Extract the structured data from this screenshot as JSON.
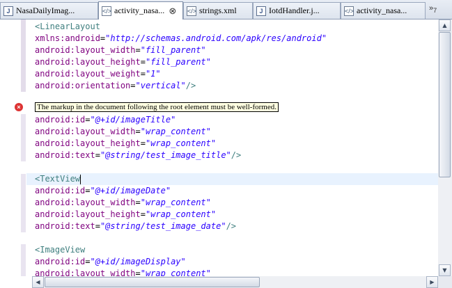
{
  "tabs": [
    {
      "label": "NasaDailyImag...",
      "icon": "java-file-icon",
      "active": false
    },
    {
      "label": "activity_nasa...",
      "icon": "xml-file-icon",
      "active": true
    },
    {
      "label": "strings.xml",
      "icon": "xml-file-icon",
      "active": false
    },
    {
      "label": "IotdHandler.j...",
      "icon": "java-file-icon",
      "active": false
    },
    {
      "label": "activity_nasa...",
      "icon": "xml-file-icon",
      "active": false
    }
  ],
  "tabs_overflow": "»",
  "tabs_overflow_count": "7",
  "close_glyph": "⊗",
  "code": [
    {
      "id": "l1",
      "parts": [
        [
          "tag",
          "<LinearLayout"
        ]
      ]
    },
    {
      "id": "l2",
      "parts": [
        [
          "attr",
          "xmlns:android"
        ],
        [
          "eq",
          "="
        ],
        [
          "val",
          "\"http://schemas.android.com/apk/res/android\""
        ]
      ]
    },
    {
      "id": "l3",
      "parts": [
        [
          "attr",
          "android:layout_width"
        ],
        [
          "eq",
          "="
        ],
        [
          "val",
          "\"fill_parent\""
        ]
      ]
    },
    {
      "id": "l4",
      "parts": [
        [
          "attr",
          "android:layout_height"
        ],
        [
          "eq",
          "="
        ],
        [
          "val",
          "\"fill_parent\""
        ]
      ]
    },
    {
      "id": "l5",
      "parts": [
        [
          "attr",
          "android:layout_weight"
        ],
        [
          "eq",
          "="
        ],
        [
          "val",
          "\"1\""
        ]
      ]
    },
    {
      "id": "l6",
      "parts": [
        [
          "attr",
          "android:orientation"
        ],
        [
          "eq",
          "="
        ],
        [
          "val",
          "\"vertical\""
        ],
        [
          "tag",
          "/>"
        ]
      ]
    },
    {
      "id": "l8",
      "parts": [
        [
          "attr",
          "android:id"
        ],
        [
          "eq",
          "="
        ],
        [
          "val",
          "\"@+id/imageTitle\""
        ]
      ]
    },
    {
      "id": "l9",
      "parts": [
        [
          "attr",
          "android:layout_width"
        ],
        [
          "eq",
          "="
        ],
        [
          "val",
          "\"wrap_content\""
        ]
      ]
    },
    {
      "id": "l10",
      "parts": [
        [
          "attr",
          "android:layout_height"
        ],
        [
          "eq",
          "="
        ],
        [
          "val",
          "\"wrap_content\""
        ]
      ]
    },
    {
      "id": "l11",
      "parts": [
        [
          "attr",
          "android:text"
        ],
        [
          "eq",
          "="
        ],
        [
          "val",
          "\"@string/test_image_title\""
        ],
        [
          "tag",
          "/>"
        ]
      ]
    },
    {
      "id": "l13",
      "parts": [
        [
          "tag",
          "<TextView"
        ]
      ]
    },
    {
      "id": "l14",
      "parts": [
        [
          "attr",
          "android:id"
        ],
        [
          "eq",
          "="
        ],
        [
          "val",
          "\"@+id/imageDate\""
        ]
      ]
    },
    {
      "id": "l15",
      "parts": [
        [
          "attr",
          "android:layout_width"
        ],
        [
          "eq",
          "="
        ],
        [
          "val",
          "\"wrap_content\""
        ]
      ]
    },
    {
      "id": "l16",
      "parts": [
        [
          "attr",
          "android:layout_height"
        ],
        [
          "eq",
          "="
        ],
        [
          "val",
          "\"wrap_content\""
        ]
      ]
    },
    {
      "id": "l17",
      "parts": [
        [
          "attr",
          "android:text"
        ],
        [
          "eq",
          "="
        ],
        [
          "val",
          "\"@string/test_image_date\""
        ],
        [
          "tag",
          "/>"
        ]
      ]
    },
    {
      "id": "l19",
      "parts": [
        [
          "tag",
          "<ImageView"
        ]
      ]
    },
    {
      "id": "l20",
      "parts": [
        [
          "attr",
          "android:id"
        ],
        [
          "eq",
          "="
        ],
        [
          "val",
          "\"@+id/imageDisplay\""
        ]
      ]
    },
    {
      "id": "l21",
      "parts": [
        [
          "attr",
          "android:layout_width"
        ],
        [
          "eq",
          "="
        ],
        [
          "val",
          "\"wrap_content\""
        ]
      ]
    }
  ],
  "error_tooltip": "The markup in the document following the root element must be well-formed.",
  "error_glyph": "×",
  "scroll": {
    "up": "▲",
    "down": "▼",
    "left": "◀",
    "right": "▶"
  },
  "colors": {
    "tag": "#3f7f7f",
    "attr": "#7f007f",
    "value": "#2a00ff",
    "current_line": "#e8f2fe",
    "tooltip_bg": "#ffffe1"
  }
}
